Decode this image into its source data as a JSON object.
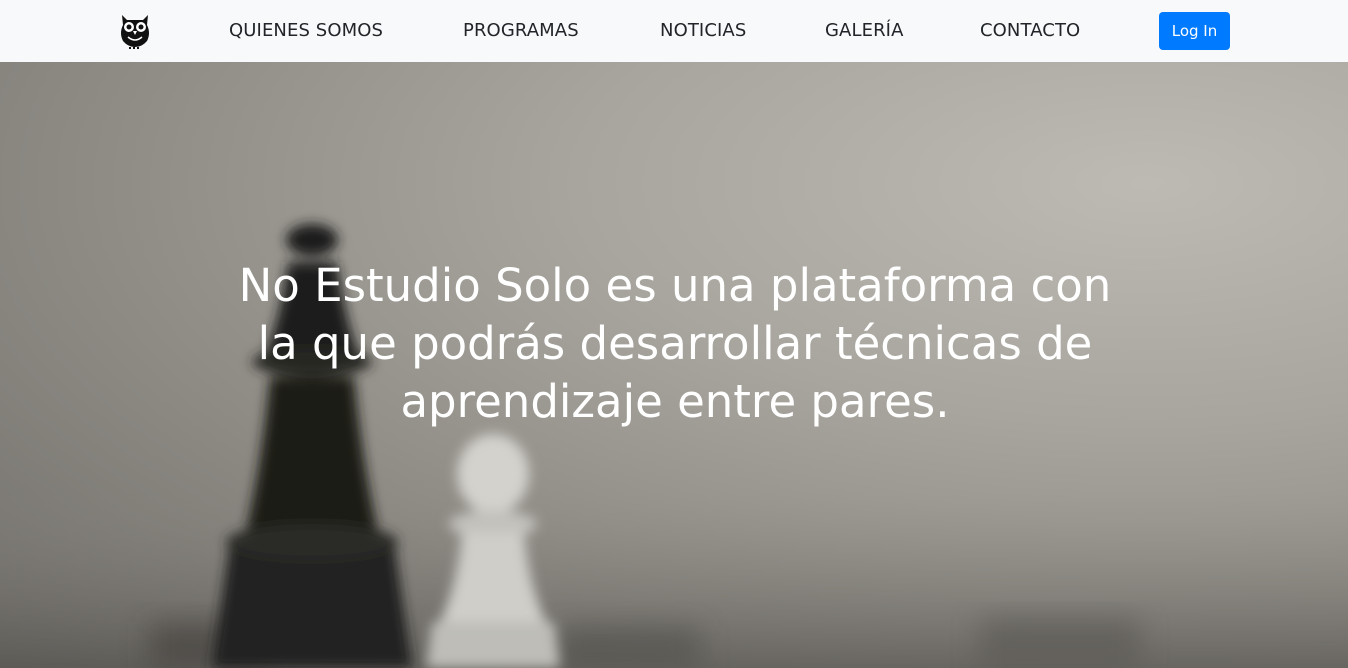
{
  "nav": {
    "logo_icon": "owl-icon",
    "links": [
      {
        "label": "QUIENES SOMOS"
      },
      {
        "label": "PROGRAMAS"
      },
      {
        "label": "NOTICIAS"
      },
      {
        "label": "GALERÍA"
      },
      {
        "label": "CONTACTO"
      }
    ],
    "login_label": "Log In"
  },
  "colors": {
    "navbar_bg": "#f8f9fa",
    "login_bg": "#007bff",
    "hero_text": "#ffffff"
  },
  "hero": {
    "title": "No Estudio Solo es una plataforma con la que podrás desarrollar técnicas de aprendizaje entre pares.",
    "background_icon": "chess-pieces-photo"
  }
}
